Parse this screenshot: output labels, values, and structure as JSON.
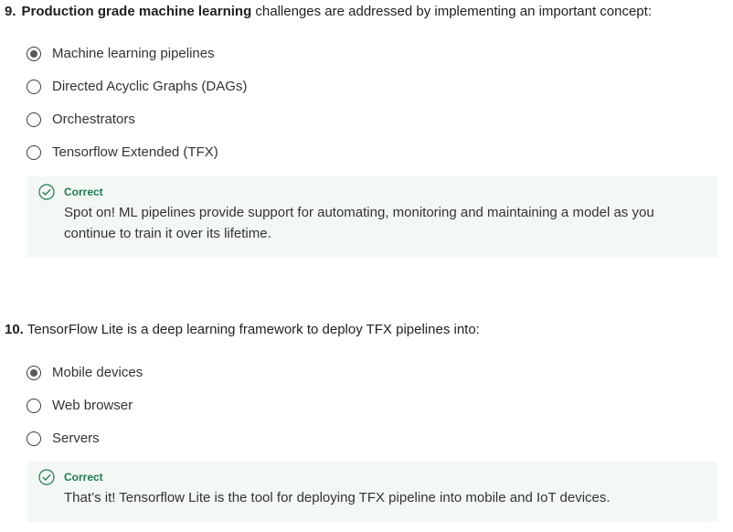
{
  "questions": [
    {
      "number": "9.",
      "prompt_bold": "Production grade machine learning",
      "prompt_rest": " challenges are addressed by implementing an important concept:",
      "options": [
        {
          "label": "Machine learning pipelines",
          "selected": true
        },
        {
          "label": "Directed Acyclic Graphs (DAGs)",
          "selected": false
        },
        {
          "label": "Orchestrators",
          "selected": false
        },
        {
          "label": "Tensorflow Extended (TFX)",
          "selected": false
        }
      ],
      "feedback": {
        "status": "Correct",
        "text": "Spot on! ML pipelines provide support for automating, monitoring and maintaining a model as you continue to train it over its lifetime."
      }
    },
    {
      "number": "10.",
      "prompt_bold": "",
      "prompt_rest": "TensorFlow Lite is a deep learning framework to deploy TFX pipelines into:",
      "options": [
        {
          "label": "Mobile devices",
          "selected": true
        },
        {
          "label": "Web browser",
          "selected": false
        },
        {
          "label": "Servers",
          "selected": false
        }
      ],
      "feedback": {
        "status": "Correct",
        "text": "That’s it! Tensorflow Lite is the tool for deploying TFX pipeline into mobile and IoT devices."
      }
    }
  ],
  "colors": {
    "correct_accent": "#1d7a4b",
    "feedback_background": "#f3f8f5"
  },
  "icons": {
    "feedback_icon": "check-circle-icon",
    "option_icon": "radio-icon"
  }
}
